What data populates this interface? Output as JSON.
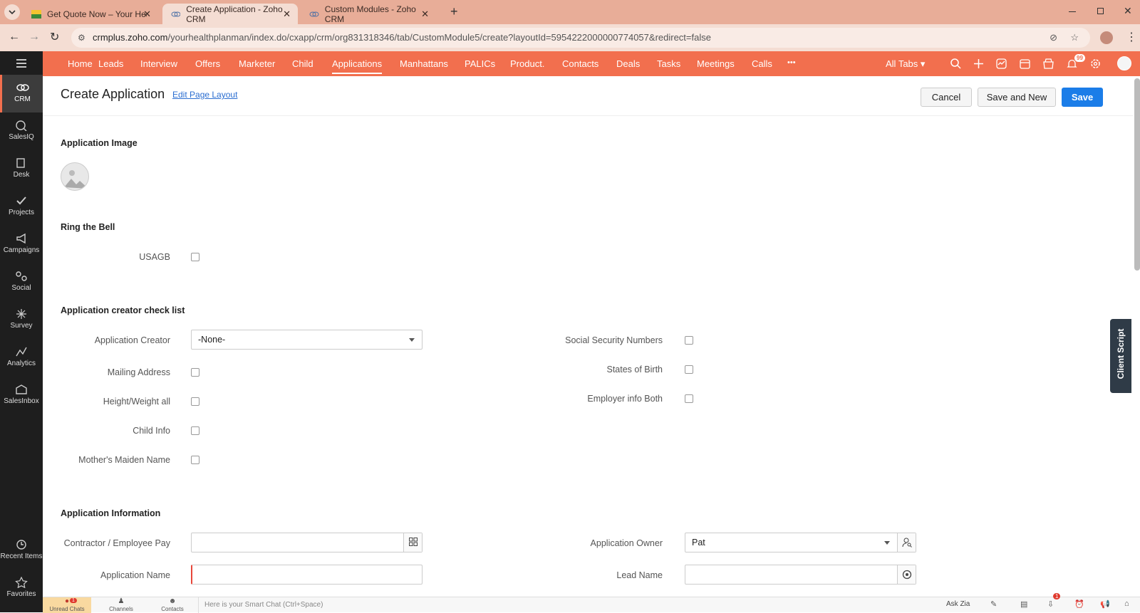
{
  "browser": {
    "tabs": [
      {
        "title": "Get Quote Now – Your Health P",
        "active": false
      },
      {
        "title": "Create Application - Zoho CRM",
        "active": true
      },
      {
        "title": "Custom Modules - Zoho CRM",
        "active": false
      }
    ],
    "url_domain": "crmplus.zoho.com",
    "url_path": "/yourhealthplanman/index.do/cxapp/crm/org831318346/tab/CustomModule5/create?layoutId=5954222000000774057&redirect=false"
  },
  "topnav": {
    "items": [
      "Home",
      "Leads",
      "Interview",
      "Offers",
      "Marketer",
      "Child",
      "Applications",
      "Manhattans",
      "PALICs",
      "Product.",
      "Contacts",
      "Deals",
      "Tasks",
      "Meetings",
      "Calls"
    ],
    "active": "Applications",
    "more": "•••",
    "all_tabs": "All Tabs",
    "notification_count": "99"
  },
  "leftnav": {
    "items": [
      "CRM",
      "SalesIQ",
      "Desk",
      "Projects",
      "Campaigns",
      "Social",
      "Survey",
      "Analytics",
      "SalesInbox"
    ],
    "bottom_items": [
      "Recent Items",
      "Favorites"
    ],
    "active": "CRM"
  },
  "header": {
    "title": "Create Application",
    "edit_layout": "Edit Page Layout",
    "cancel": "Cancel",
    "save_and_new": "Save and New",
    "save": "Save"
  },
  "sections": {
    "image": {
      "title": "Application Image"
    },
    "ring": {
      "title": "Ring the Bell",
      "usagb": "USAGB"
    },
    "checklist": {
      "title": "Application creator check list",
      "application_creator_label": "Application Creator",
      "application_creator_value": "-None-",
      "mailing_address": "Mailing Address",
      "height_weight": "Height/Weight all",
      "child_info": "Child Info",
      "mothers_maiden": "Mother's Maiden Name",
      "ssn": "Social Security Numbers",
      "states_of_birth": "States of Birth",
      "employer_info": "Employer info Both"
    },
    "info": {
      "title": "Application Information",
      "contractor_label": "Contractor / Employee Pay",
      "application_name_label": "Application Name",
      "owner_label": "Application Owner",
      "owner_value": "Pat",
      "lead_name_label": "Lead Name"
    }
  },
  "client_script": "Client Script",
  "bottombar": {
    "unread_chats": "Unread Chats",
    "unread_count": "1",
    "channels": "Channels",
    "contacts": "Contacts",
    "smart_chat_placeholder": "Here is your Smart Chat (Ctrl+Space)",
    "ask_zia": "Ask Zia",
    "download_count": "1"
  }
}
